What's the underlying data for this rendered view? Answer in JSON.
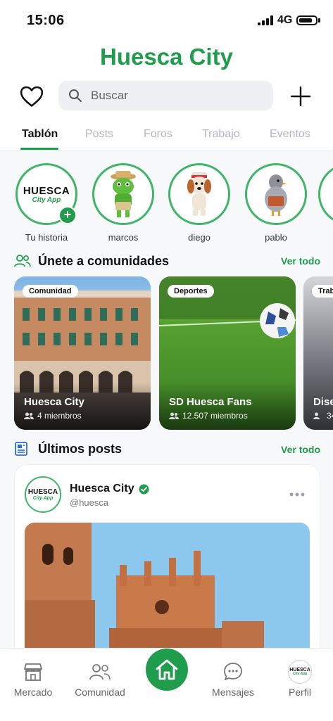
{
  "status": {
    "time": "15:06",
    "network": "4G"
  },
  "header": {
    "title": "Huesca City"
  },
  "search": {
    "placeholder": "Buscar"
  },
  "tabs": [
    {
      "label": "Tablón"
    },
    {
      "label": "Posts"
    },
    {
      "label": "Foros"
    },
    {
      "label": "Trabajo"
    },
    {
      "label": "Eventos"
    }
  ],
  "stories": [
    {
      "label": "Tu historia"
    },
    {
      "label": "marcos"
    },
    {
      "label": "diego"
    },
    {
      "label": "pablo"
    }
  ],
  "logo": {
    "line1": "HUESCA",
    "line2": "City App"
  },
  "communities": {
    "title": "Únete a comunidades",
    "see_all": "Ver todo",
    "cards": [
      {
        "badge": "Comunidad",
        "name": "Huesca City",
        "members": "4 miembros"
      },
      {
        "badge": "Deportes",
        "name": "SD Huesca Fans",
        "members": "12.507 miembros"
      },
      {
        "badge": "Trab",
        "name": "Dise",
        "members": "34"
      }
    ]
  },
  "posts": {
    "title": "Últimos posts",
    "see_all": "Ver todo",
    "first": {
      "author": "Huesca City",
      "handle": "@huesca"
    }
  },
  "nav": [
    {
      "label": "Mercado"
    },
    {
      "label": "Comunidad"
    },
    {
      "label": "Mensajes"
    },
    {
      "label": "Perfil"
    }
  ],
  "colors": {
    "accent": "#1f9d4c",
    "link": "#1f9d4c"
  }
}
